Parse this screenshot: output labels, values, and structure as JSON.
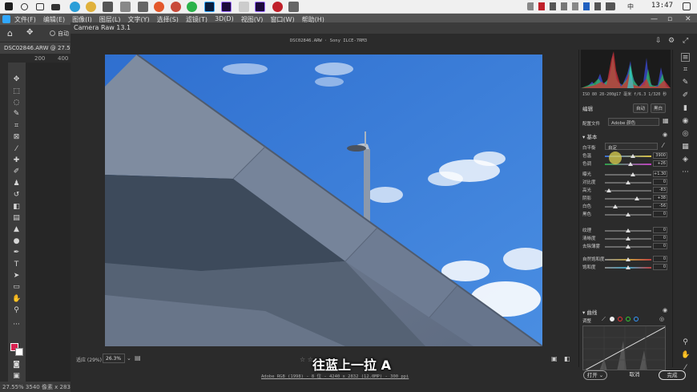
{
  "taskbar": {
    "time": "13:47",
    "lang": "中"
  },
  "ps": {
    "menu": [
      "文件(F)",
      "编辑(E)",
      "图像(I)",
      "图层(L)",
      "文字(Y)",
      "选择(S)",
      "滤镜(T)",
      "3D(D)",
      "视图(V)",
      "窗口(W)",
      "帮助(H)"
    ],
    "options_auto": "自动",
    "doc_tab": "DSC02846.ARW @ 27.5% (",
    "ruler_marks": [
      "200",
      "400"
    ],
    "status": "27.55%   3540 像素 x 2832 像"
  },
  "camera_raw": {
    "title": "Camera Raw 13.1",
    "filename": "DSC02846.ARW · Sony ILCE-7RM3",
    "fit_label": "适应 (29%)",
    "zoom": "26.3%",
    "subtitle": "往蓝上一拉 A",
    "footer_info": "Adobe RGB (1998) - 8 位 - 4240 x 2832 (12.0MP) - 300 ppi",
    "open_button": "打开",
    "cancel_button": "取消",
    "done_button": "完成"
  },
  "panel": {
    "hist_info": "ISO 80   28-200@17 毫米   f/6.3   1/320 秒",
    "edit_label": "编辑",
    "auto_button": "自动",
    "bw_button": "黑白",
    "profile_label": "配置文件",
    "profile_value": "Adobe 颜色",
    "basic_label": "基本",
    "wb_label": "白平衡",
    "wb_value": "自定",
    "curve_label": "曲线",
    "adjust_label": "调整",
    "sliders": [
      {
        "label": "色温",
        "value": "3900",
        "pos": 0.6
      },
      {
        "label": "色调",
        "value": "+26",
        "pos": 0.55
      },
      {
        "label": "曝光",
        "value": "+1.30",
        "pos": 0.61
      },
      {
        "label": "对比度",
        "value": "0",
        "pos": 0.5
      },
      {
        "label": "高光",
        "value": "-83",
        "pos": 0.08
      },
      {
        "label": "阴影",
        "value": "+38",
        "pos": 0.69
      },
      {
        "label": "白色",
        "value": "-56",
        "pos": 0.22
      },
      {
        "label": "黑色",
        "value": "0",
        "pos": 0.5
      },
      {
        "label": "纹理",
        "value": "0",
        "pos": 0.5
      },
      {
        "label": "清晰度",
        "value": "0",
        "pos": 0.5
      },
      {
        "label": "去除薄雾",
        "value": "0",
        "pos": 0.5
      },
      {
        "label": "自然饱和度",
        "value": "0",
        "pos": 0.5
      },
      {
        "label": "饱和度",
        "value": "0",
        "pos": 0.5
      }
    ]
  },
  "colors": {
    "sky": "#3a7ad6",
    "accent": "#31a8ff"
  }
}
